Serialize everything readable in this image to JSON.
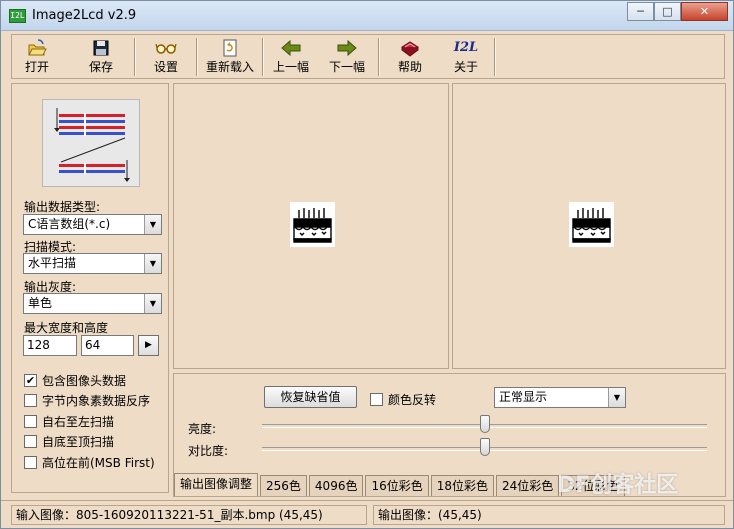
{
  "window": {
    "title": "Image2Lcd v2.9",
    "icon_text": "I2L",
    "minimize": "─",
    "maximize": "□",
    "close": "✕"
  },
  "toolbar": {
    "open": "打开",
    "save": "保存",
    "settings": "设置",
    "reload": "重新载入",
    "prev": "上一幅",
    "next": "下一幅",
    "help": "帮助",
    "about": "关于",
    "about_icon_text": "I2L"
  },
  "left_panel": {
    "output_type_label": "输出数据类型:",
    "output_type_value": "C语言数组(*.c)",
    "scan_mode_label": "扫描模式:",
    "scan_mode_value": "水平扫描",
    "gray_label": "输出灰度:",
    "gray_value": "单色",
    "max_size_label": "最大宽度和高度",
    "max_width": "128",
    "max_height": "64",
    "checkboxes": [
      {
        "label": "包含图像头数据",
        "checked": true
      },
      {
        "label": "字节内象素数据反序",
        "checked": false
      },
      {
        "label": "自右至左扫描",
        "checked": false
      },
      {
        "label": "自底至顶扫描",
        "checked": false
      },
      {
        "label": "高位在前(MSB First)",
        "checked": false
      }
    ],
    "checkmark": "✔"
  },
  "bottom_panel": {
    "restore_default": "恢复缺省值",
    "invert_colors": "颜色反转",
    "display_mode": "正常显示",
    "brightness_label": "亮度:",
    "contrast_label": "对比度:",
    "brightness_level": 0.5,
    "contrast_level": 0.5,
    "tabs": [
      "输出图像调整",
      "256色",
      "4096色",
      "16位彩色",
      "18位彩色",
      "24位彩色",
      "32位彩色"
    ]
  },
  "status_bar": {
    "input": "输入图像：805-160920113221-51_副本.bmp (45,45)",
    "output": "输出图像：(45,45)"
  },
  "watermark": "DF创客社区",
  "colors": {
    "panel_bg": "#eedcc7",
    "title_bg": "#c3d6ec",
    "scan_red": "#d8202a",
    "scan_blue": "#3850c8"
  }
}
